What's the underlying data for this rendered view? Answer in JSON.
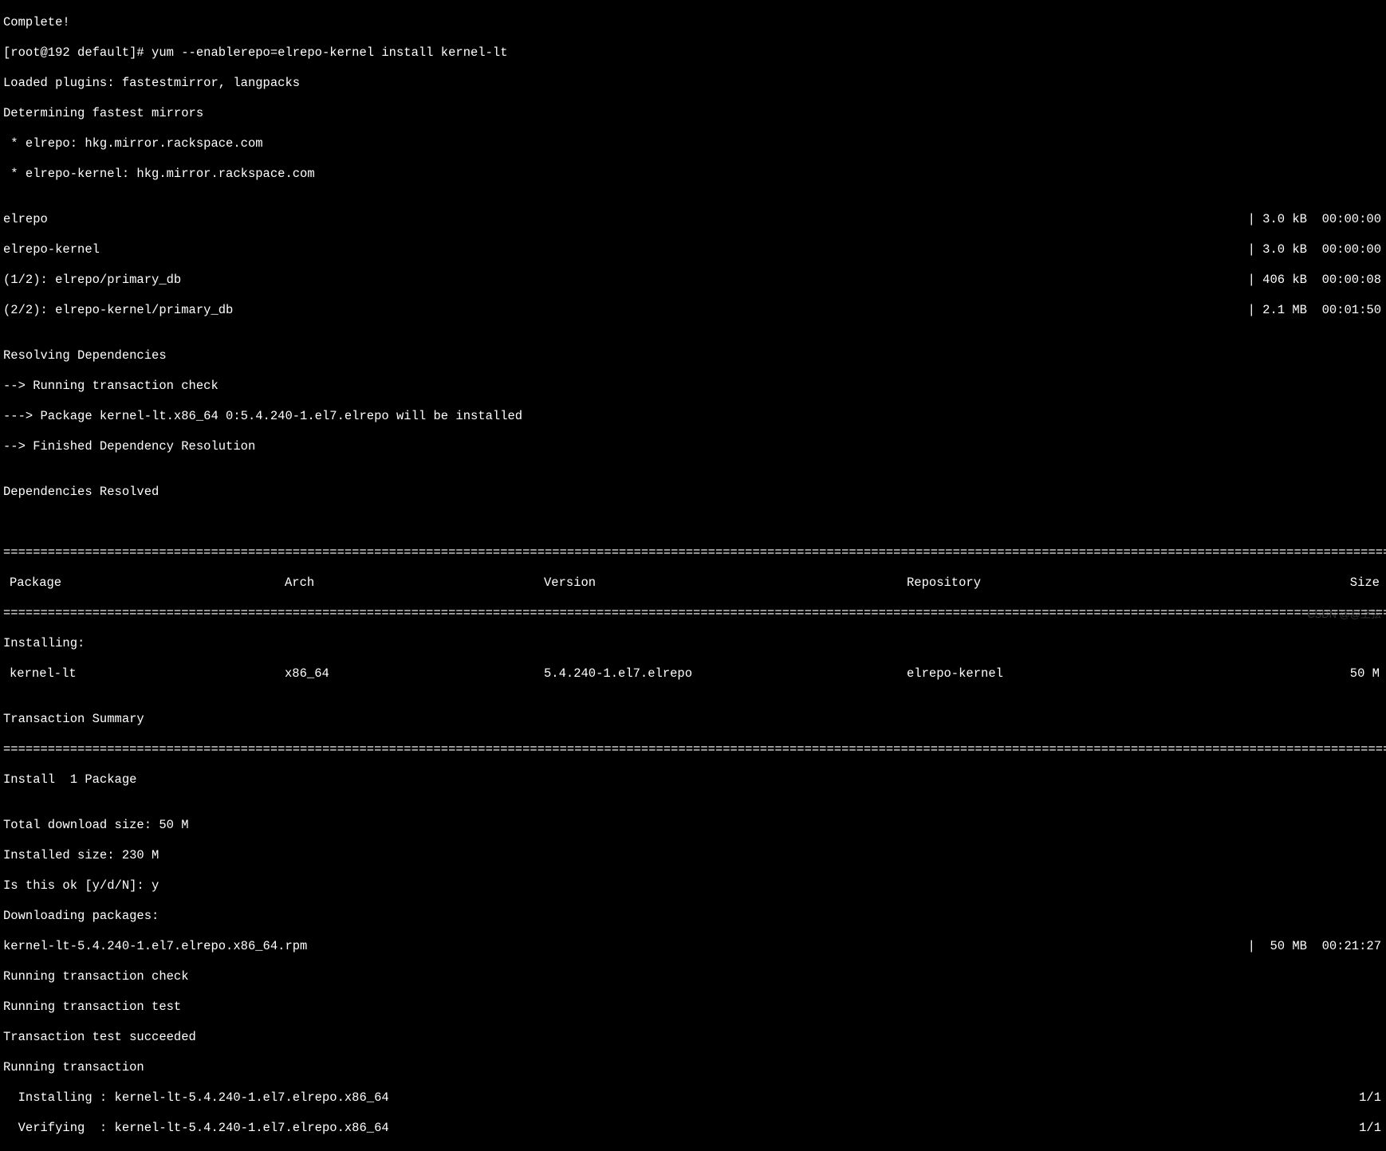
{
  "lines": {
    "complete": "Complete!",
    "prompt": "[root@192 default]# yum --enablerepo=elrepo-kernel install kernel-lt",
    "loaded": "Loaded plugins: fastestmirror, langpacks",
    "determining": "Determining fastest mirrors",
    "mirror1": " * elrepo: hkg.mirror.rackspace.com",
    "mirror2": " * elrepo-kernel: hkg.mirror.rackspace.com",
    "resolving": "Resolving Dependencies",
    "trcheck": "--> Running transaction check",
    "pkgline": "---> Package kernel-lt.x86_64 0:5.4.240-1.el7.elrepo will be installed",
    "finres": "--> Finished Dependency Resolution",
    "blank": "",
    "depres": "Dependencies Resolved",
    "installing_hdr": "Installing:",
    "trsummary": "Transaction Summary",
    "install_count": "Install  1 Package",
    "totdl": "Total download size: 50 M",
    "instsize": "Installed size: 230 M",
    "isok": "Is this ok [y/d/N]: y",
    "dlpkgs": "Downloading packages:",
    "runtrcheck": "Running transaction check",
    "runtrtest": "Running transaction test",
    "trtestok": "Transaction test succeeded",
    "runtr": "Running transaction",
    "instline": "  Installing : kernel-lt-5.4.240-1.el7.elrepo.x86_64",
    "verline": "  Verifying  : kernel-lt-5.4.240-1.el7.elrepo.x86_64"
  },
  "repo_fetch": [
    {
      "name": "elrepo",
      "size": "| 3.0 kB  00:00:00"
    },
    {
      "name": "elrepo-kernel",
      "size": "| 3.0 kB  00:00:00"
    },
    {
      "name": "(1/2): elrepo/primary_db",
      "size": "| 406 kB  00:00:08"
    },
    {
      "name": "(2/2): elrepo-kernel/primary_db",
      "size": "| 2.1 MB  00:01:50"
    }
  ],
  "rule": "=============================================================================================================================================================================================================",
  "rule_short": "================================================================================================================================================================================================",
  "table": {
    "headers": {
      "pkg": "Package",
      "arch": "Arch",
      "ver": "Version",
      "repo": "Repository",
      "size": "Size"
    },
    "row": {
      "pkg": "kernel-lt",
      "arch": "x86_64",
      "ver": "5.4.240-1.el7.elrepo",
      "repo": "elrepo-kernel",
      "size": "50 M"
    }
  },
  "download": {
    "file": "kernel-lt-5.4.240-1.el7.elrepo.x86_64.rpm",
    "stat": "|  50 MB  00:21:27"
  },
  "progress": {
    "inst": "1/1",
    "ver": "1/1"
  },
  "watermark": "CSDN @@上弦"
}
